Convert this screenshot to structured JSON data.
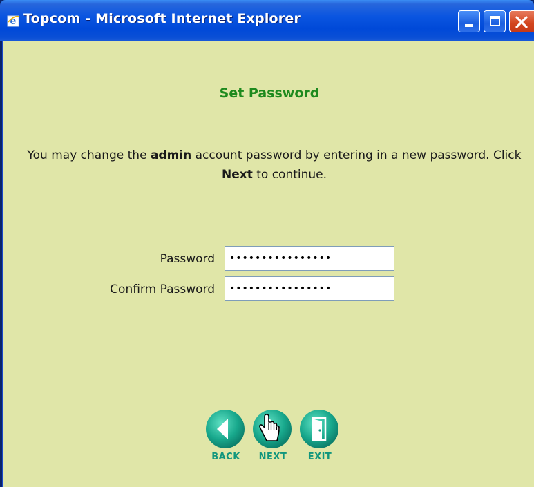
{
  "window": {
    "title": "Topcom - Microsoft Internet Explorer"
  },
  "page": {
    "title": "Set Password",
    "intro_part1": "You may change the ",
    "intro_bold1": "admin",
    "intro_part2": " account password by entering in a new password. Click ",
    "intro_bold2": "Next",
    "intro_part3": " to continue."
  },
  "form": {
    "password_label": "Password",
    "password_value": "••••••••••••••••",
    "confirm_label": "Confirm Password",
    "confirm_value": "••••••••••••••••"
  },
  "nav": {
    "back_label": "BACK",
    "next_label": "NEXT",
    "exit_label": "EXIT"
  },
  "colors": {
    "page_background": "#e0e6a8",
    "title_green": "#1e8a1e",
    "button_teal": "#11967d",
    "titlebar_blue": "#0049d8"
  }
}
